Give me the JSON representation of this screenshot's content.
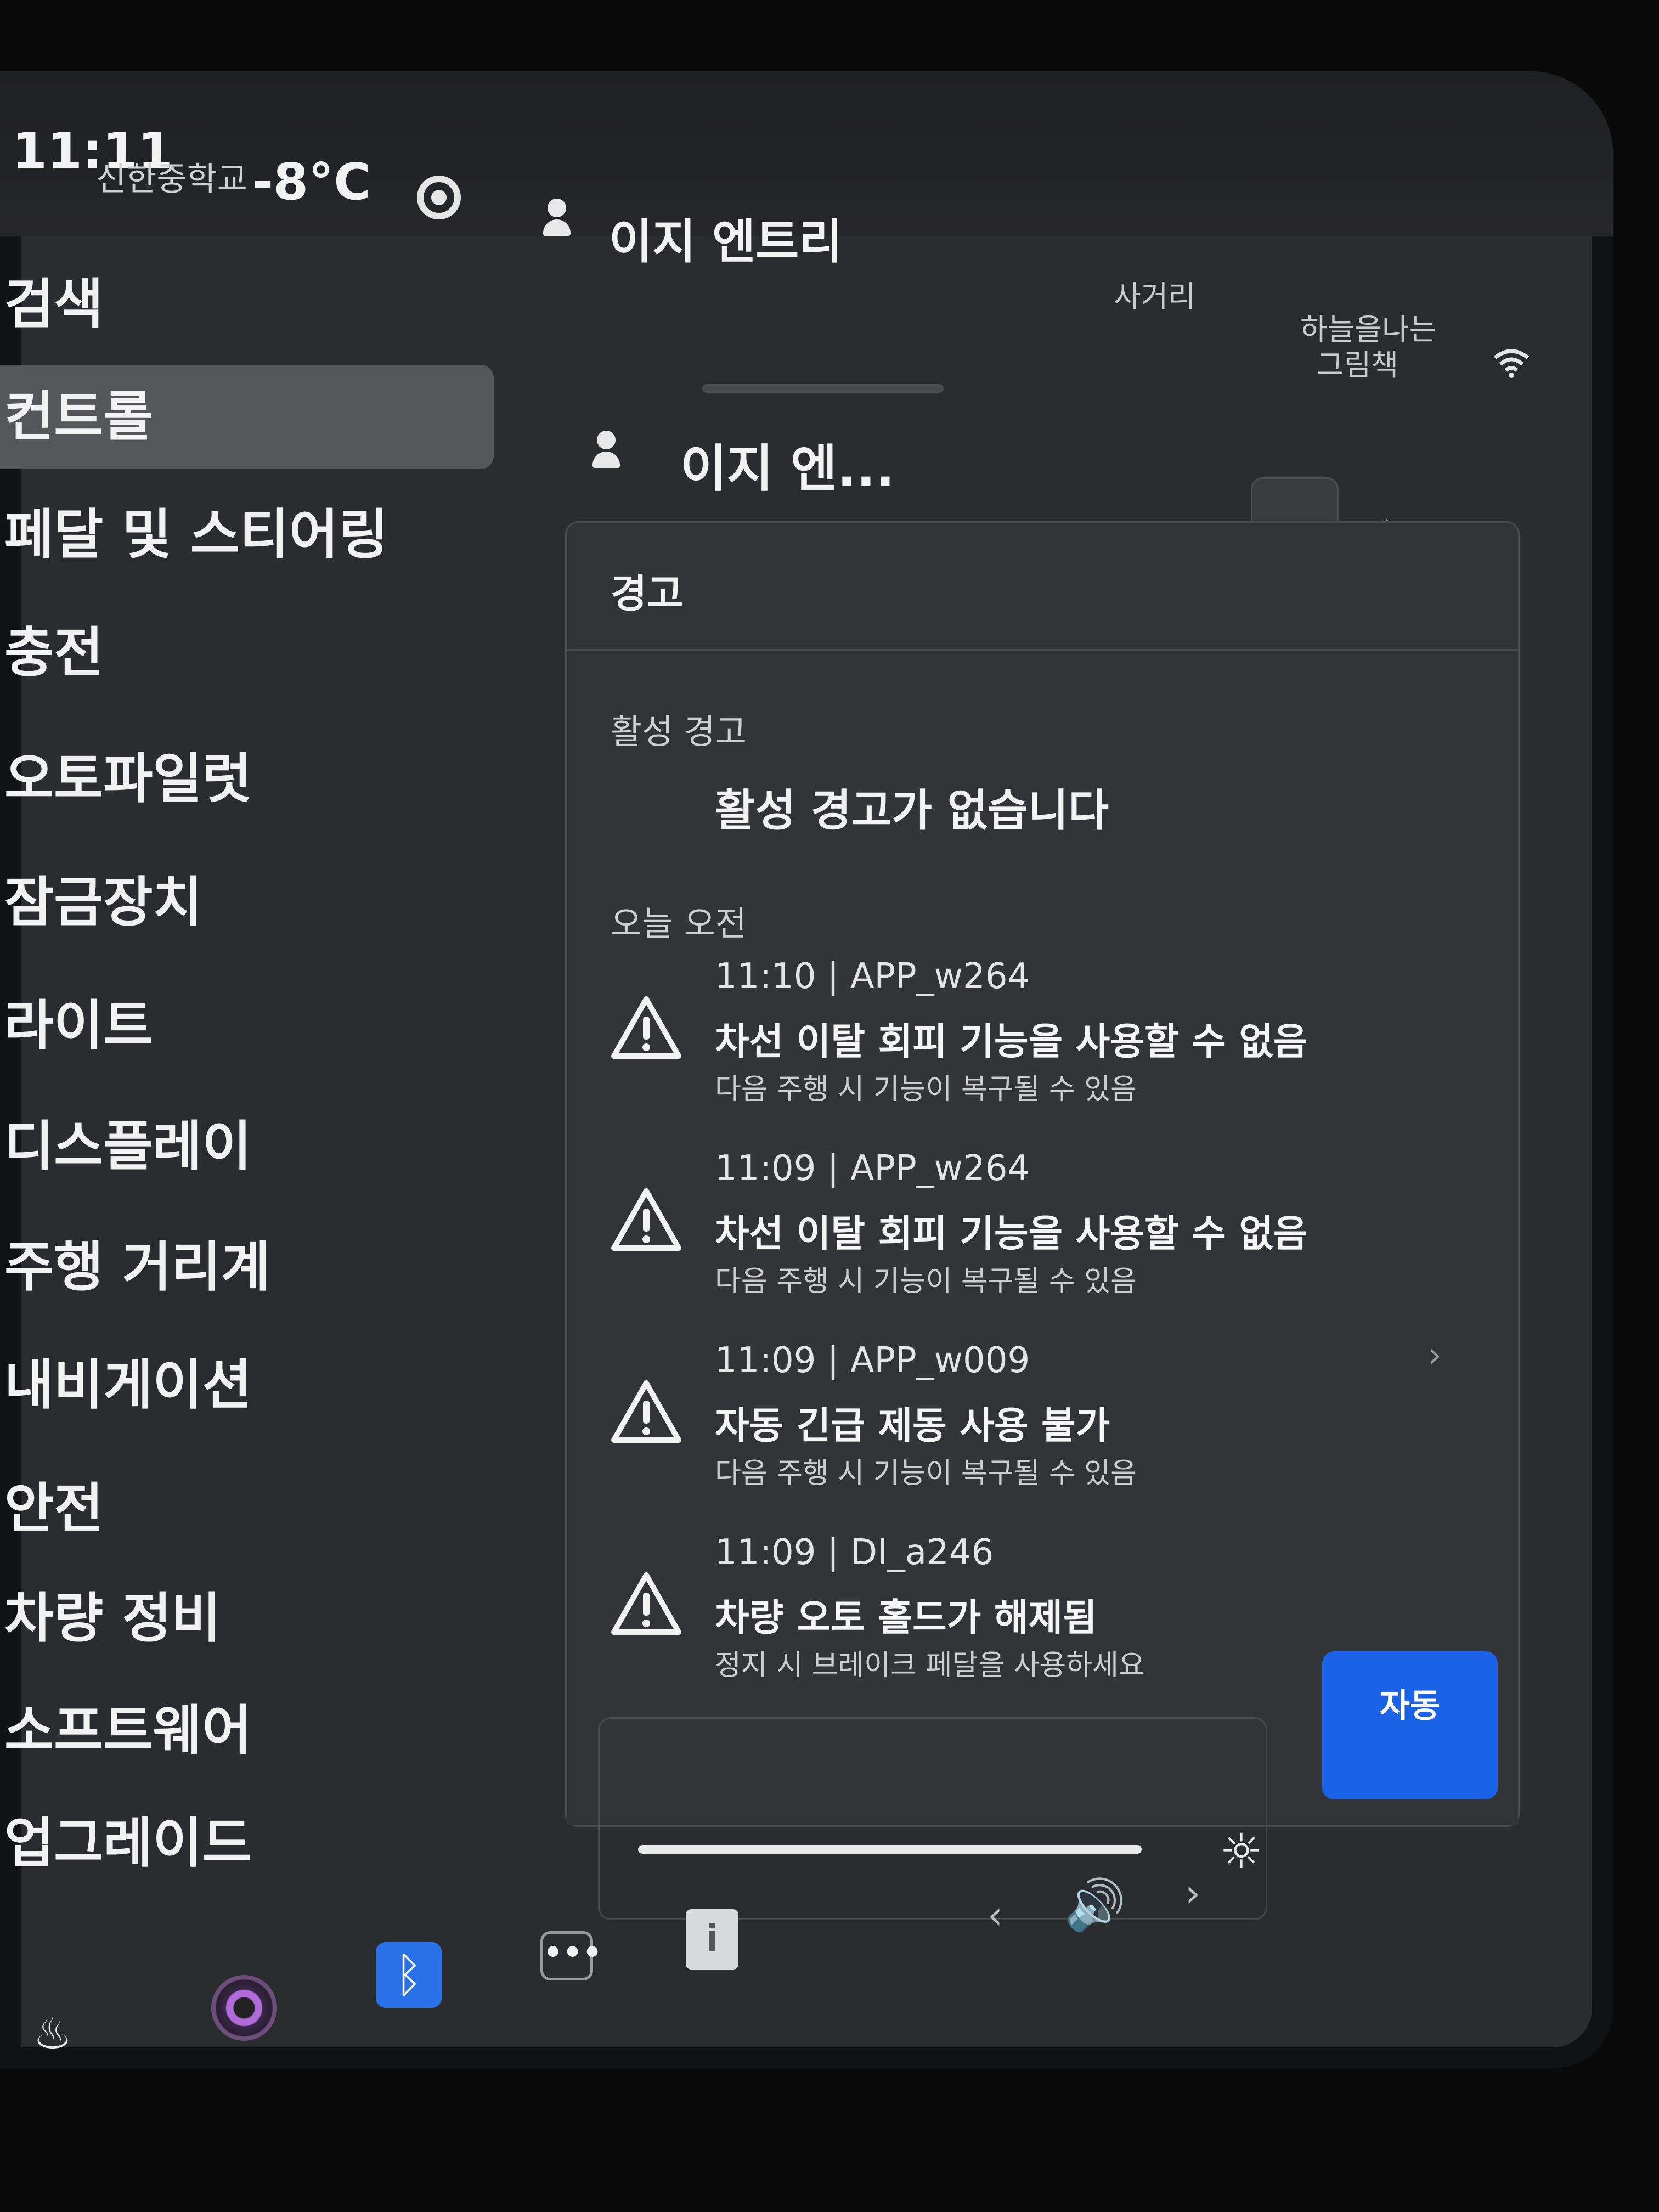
{
  "status_bar": {
    "time": "11:11",
    "place": "신한중학교",
    "temperature": "-8°C",
    "profile_name": "이지 엔트리",
    "map_labels": [
      "사거리",
      "하늘을나는",
      "그림책"
    ]
  },
  "sidebar": {
    "items": [
      {
        "label": "검색"
      },
      {
        "label": "컨트롤"
      },
      {
        "label": "페달 및 스티어링"
      },
      {
        "label": "충전"
      },
      {
        "label": "오토파일럿"
      },
      {
        "label": "잠금장치"
      },
      {
        "label": "라이트"
      },
      {
        "label": "디스플레이"
      },
      {
        "label": "주행 거리계"
      },
      {
        "label": "내비게이션"
      },
      {
        "label": "안전"
      },
      {
        "label": "차량 정비"
      },
      {
        "label": "소프트웨어"
      },
      {
        "label": "업그레이드"
      }
    ],
    "active": "컨트롤"
  },
  "main": {
    "profile_name": "이지 엔..."
  },
  "panel": {
    "title": "경고",
    "tabs": [
      {
        "icon": "bell-icon",
        "active": true
      },
      {
        "icon": "bluetooth-icon",
        "active": false
      },
      {
        "icon": "wifi-icon",
        "active": false
      }
    ],
    "active_label": "활성 경고",
    "no_active_message": "활성 경고가 없습니다",
    "today_label": "오늘 오전",
    "alerts": [
      {
        "meta": "11:10 | APP_w264",
        "title": "차선 이탈 회피 기능을 사용할 수 없음",
        "desc": "다음 주행 시 기능이 복구될 수 있음"
      },
      {
        "meta": "11:09 | APP_w264",
        "title": "차선 이탈 회피 기능을 사용할 수 없음",
        "desc": "다음 주행 시 기능이 복구될 수 있음"
      },
      {
        "meta": "11:09 | APP_w009",
        "title": "자동 긴급 제동 사용 불가",
        "desc": "다음 주행 시 기능이 복구될 수 있음"
      },
      {
        "meta": "11:09 | DI_a246",
        "title": "차량 오토 홀드가 해제됨",
        "desc": "정지 시 브레이크 페달을 사용하세요"
      }
    ]
  },
  "display_controls": {
    "auto_label": "자동",
    "brightness": 0.9
  },
  "dock": {
    "icons": [
      "defrost-icon",
      "camera-icon",
      "bluetooth-icon",
      "more-icon",
      "manual-icon",
      "prev-arrow-icon",
      "volume-icon",
      "next-arrow-icon"
    ],
    "more_glyph": "•••",
    "manual_glyph": "i"
  }
}
